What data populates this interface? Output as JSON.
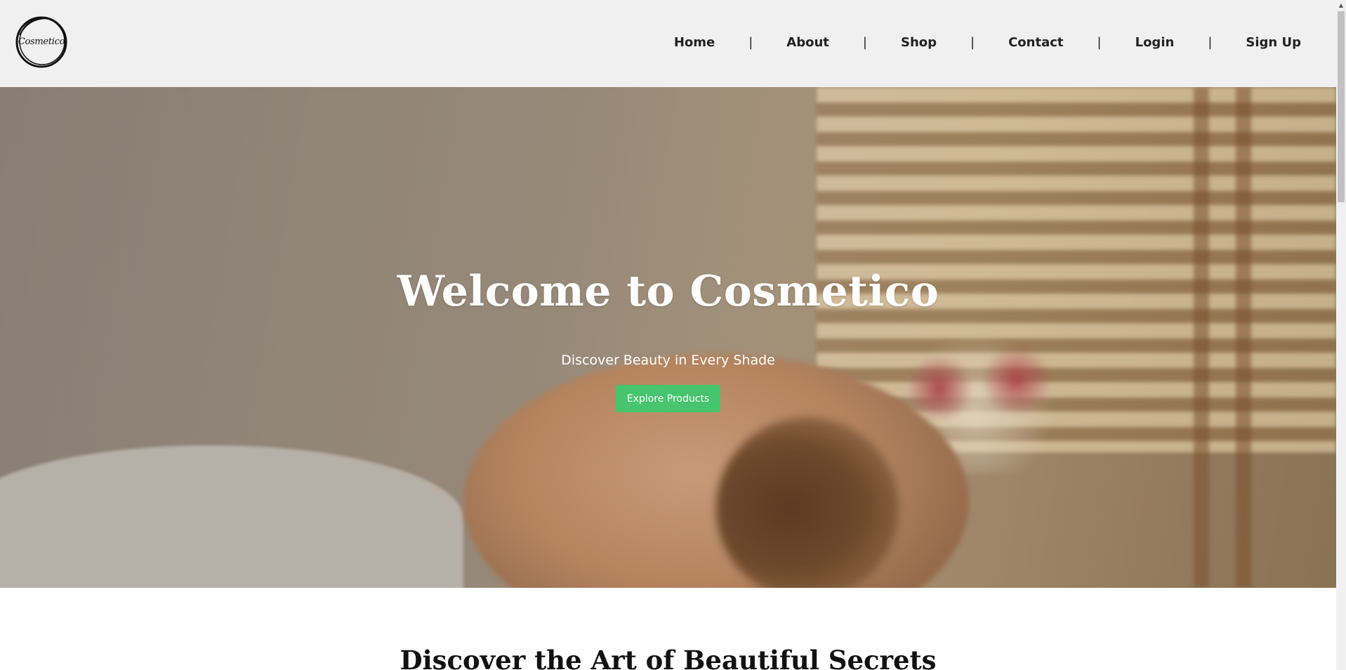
{
  "logo": {
    "text": "Cosmetico"
  },
  "nav": {
    "items": [
      "Home",
      "About",
      "Shop",
      "Contact",
      "Login",
      "Sign Up"
    ],
    "separator": "|"
  },
  "hero": {
    "title": "Welcome to Cosmetico",
    "subtitle": "Discover Beauty in Every Shade",
    "button_label": "Explore Products",
    "button_color": "#46c46e"
  },
  "section": {
    "title": "Discover the Art of Beautiful Secrets"
  },
  "scrollbar": {
    "arrow_up_icon": "▲"
  }
}
